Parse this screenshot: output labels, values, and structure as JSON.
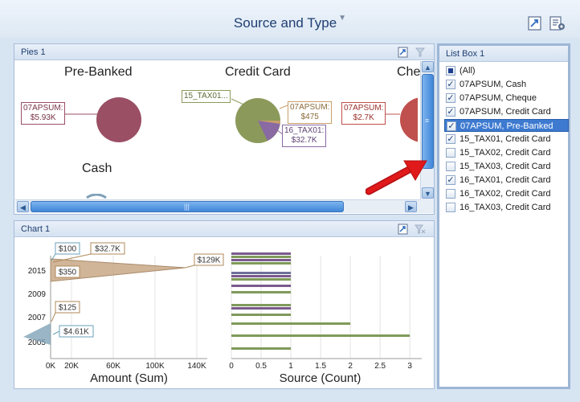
{
  "dashboard": {
    "title": "Source and Type"
  },
  "pies_panel": {
    "title": "Pies 1",
    "pies": [
      {
        "title": "Pre-Banked",
        "slices": [
          {
            "label": "07APSUM:\n$5.93K",
            "value": 5930,
            "color": "#9a4f64"
          }
        ]
      },
      {
        "title": "Credit Card",
        "slices": [
          {
            "label": "15_TAX01...",
            "value": 3700,
            "color": "#8b9a5b"
          },
          {
            "label": "07APSUM:\n$475",
            "value": 475,
            "color": "#c8a06a"
          },
          {
            "label": "16_TAX01:\n$32.7K",
            "value": 32700,
            "color": "#8a6aa2"
          }
        ]
      },
      {
        "title": "Che",
        "slices": [
          {
            "label": "07APSUM:\n$2.7K",
            "value": 2700,
            "color": "#c0504d"
          }
        ]
      },
      {
        "title": "Cash",
        "slices": []
      }
    ]
  },
  "chart_panel": {
    "title": "Chart 1"
  },
  "listbox": {
    "title": "List Box 1",
    "items": [
      {
        "label": "(All)",
        "state": "partial"
      },
      {
        "label": "07APSUM, Cash",
        "state": "checked"
      },
      {
        "label": "07APSUM, Cheque",
        "state": "checked"
      },
      {
        "label": "07APSUM, Credit Card",
        "state": "checked"
      },
      {
        "label": "07APSUM, Pre-Banked",
        "state": "checked",
        "selected": true
      },
      {
        "label": "15_TAX01, Credit Card",
        "state": "checked"
      },
      {
        "label": "15_TAX02, Credit Card",
        "state": "unchecked"
      },
      {
        "label": "15_TAX03, Credit Card",
        "state": "unchecked"
      },
      {
        "label": "16_TAX01, Credit Card",
        "state": "checked"
      },
      {
        "label": "16_TAX02, Credit Card",
        "state": "unchecked"
      },
      {
        "label": "16_TAX03, Credit Card",
        "state": "unchecked"
      }
    ]
  },
  "chart_data": [
    {
      "type": "area",
      "xlabel": "Amount (Sum)",
      "x_ticks": [
        "0K",
        "20K",
        "60K",
        "100K",
        "140K"
      ],
      "xlim": [
        0,
        150000
      ],
      "y_ticks": [
        "2015",
        "2009",
        "2007",
        "2005"
      ],
      "categories": [
        "2015",
        "2009",
        "2007",
        "2005"
      ],
      "series": [
        {
          "values": [
            129000,
            350,
            125,
            4610
          ],
          "color": "#c9a886"
        }
      ],
      "annotations": [
        "$100",
        "$32.7K",
        "$129K",
        "$350",
        "$125",
        "$4.61K"
      ]
    },
    {
      "type": "bar",
      "xlabel": "Source (Count)",
      "x_ticks": [
        "0",
        "0.5",
        "1",
        "1.5",
        "2",
        "2.5",
        "3"
      ],
      "xlim": [
        0,
        3.2
      ],
      "bars": [
        {
          "value": 1,
          "color": "#7a5a8e"
        },
        {
          "value": 1,
          "color": "#7f9a5a"
        },
        {
          "value": 1,
          "color": "#7a5a8e"
        },
        {
          "value": 1,
          "color": "#7f9a5a"
        },
        {
          "value": 1,
          "color": "#6f6f9a"
        },
        {
          "value": 1,
          "color": "#7a5a8e"
        },
        {
          "value": 1,
          "color": "#7f9a5a"
        },
        {
          "value": 1,
          "color": "#7a5a8e"
        },
        {
          "value": 1,
          "color": "#7f9a5a"
        },
        {
          "value": 1,
          "color": "#7f9a5a"
        },
        {
          "value": 1,
          "color": "#7a5a8e"
        },
        {
          "value": 1,
          "color": "#7f9a5a"
        },
        {
          "value": 2,
          "color": "#7f9a5a"
        },
        {
          "value": 3,
          "color": "#7f9a5a"
        },
        {
          "value": 1,
          "color": "#7f9a5a"
        }
      ]
    }
  ],
  "colors": {
    "accent": "#3d7ad0",
    "panel_border": "#a8bcd8",
    "arrow": "#e0191b"
  }
}
